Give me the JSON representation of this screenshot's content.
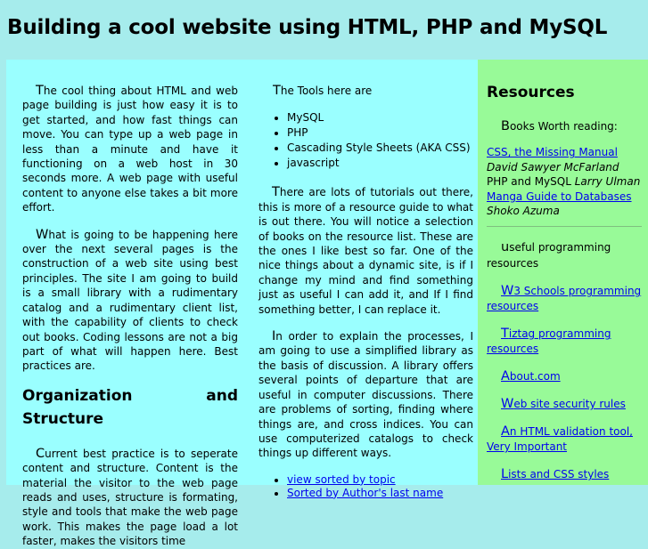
{
  "header": {
    "title": "Building a cool website using HTML, PHP and MySQL"
  },
  "col1": {
    "p1_first": "T",
    "p1_rest": "he cool thing about HTML and web page building is just how easy it is to get started, and how fast things can move. You can type up a web page in less than a minute and have it functioning on a web host in 30 seconds more. A web page with useful content to anyone else takes a bit more effort.",
    "p2_first": "W",
    "p2_rest": "hat is going to be happening here over the next several pages is the construction of a web site using best principles. The site I am going to build is a small library with a rudimentary catalog and a rudimentary client list, with the capability of clients to check out books. Coding lessons are not a big part of what will happen here. Best practices are.",
    "heading": "Organization and Structure",
    "p3_first": "C",
    "p3_rest": "urrent best practice is to seperate content and structure. Content is the material the visitor to the web page reads and uses, structure is formating, style and tools that make the web page work. This makes the page load a lot faster, makes the visitors time"
  },
  "col2": {
    "tools_first": "T",
    "tools_rest": "he Tools here are",
    "tools": [
      "MySQL",
      "PHP",
      "Cascading Style Sheets (AKA CSS)",
      "javascript"
    ],
    "p1_first": "T",
    "p1_rest": "here are lots of tutorials out there, this is more of a resource guide to what is out there. You will notice a selection of books on the resource list. These are the ones I like best so far. One of the nice things about a dynamic site, is if I change my mind and find something just as useful I can add it, and If I find something better, I can replace it.",
    "p2_first": "I",
    "p2_rest": "n order to explain the processes, I am going to use a simplified library as the basis of discussion. A library offers several points of departure that are useful in computer discussions. There are problems of sorting, finding where things are, and cross indices. You can use computerized catalogs to check things up different ways.",
    "links": [
      "view sorted by topic",
      "Sorted by Author's last name"
    ]
  },
  "sidebar": {
    "title": "Resources",
    "books_first": "B",
    "books_rest": "ooks Worth reading:",
    "book1_link": "CSS, the Missing Manual",
    "book1_author": "David Sawyer McFarland",
    "book2_title": "PHP and MySQL",
    "book2_author": "Larry Ulman",
    "book3_link": "Manga Guide to Databases",
    "book3_author": "Shoko Azuma",
    "useful_first": "u",
    "useful_rest": "seful programming resources",
    "links": [
      {
        "first": "W",
        "rest": "3 Schools programming resources"
      },
      {
        "first": "T",
        "rest": "iztag programming resources"
      },
      {
        "first": "A",
        "rest": "bout.com"
      },
      {
        "first": "W",
        "rest": "eb site security rules"
      },
      {
        "first": "A",
        "rest": "n HTML validation tool, Very Important"
      },
      {
        "first": "L",
        "rest": "ists and CSS styles"
      }
    ]
  }
}
